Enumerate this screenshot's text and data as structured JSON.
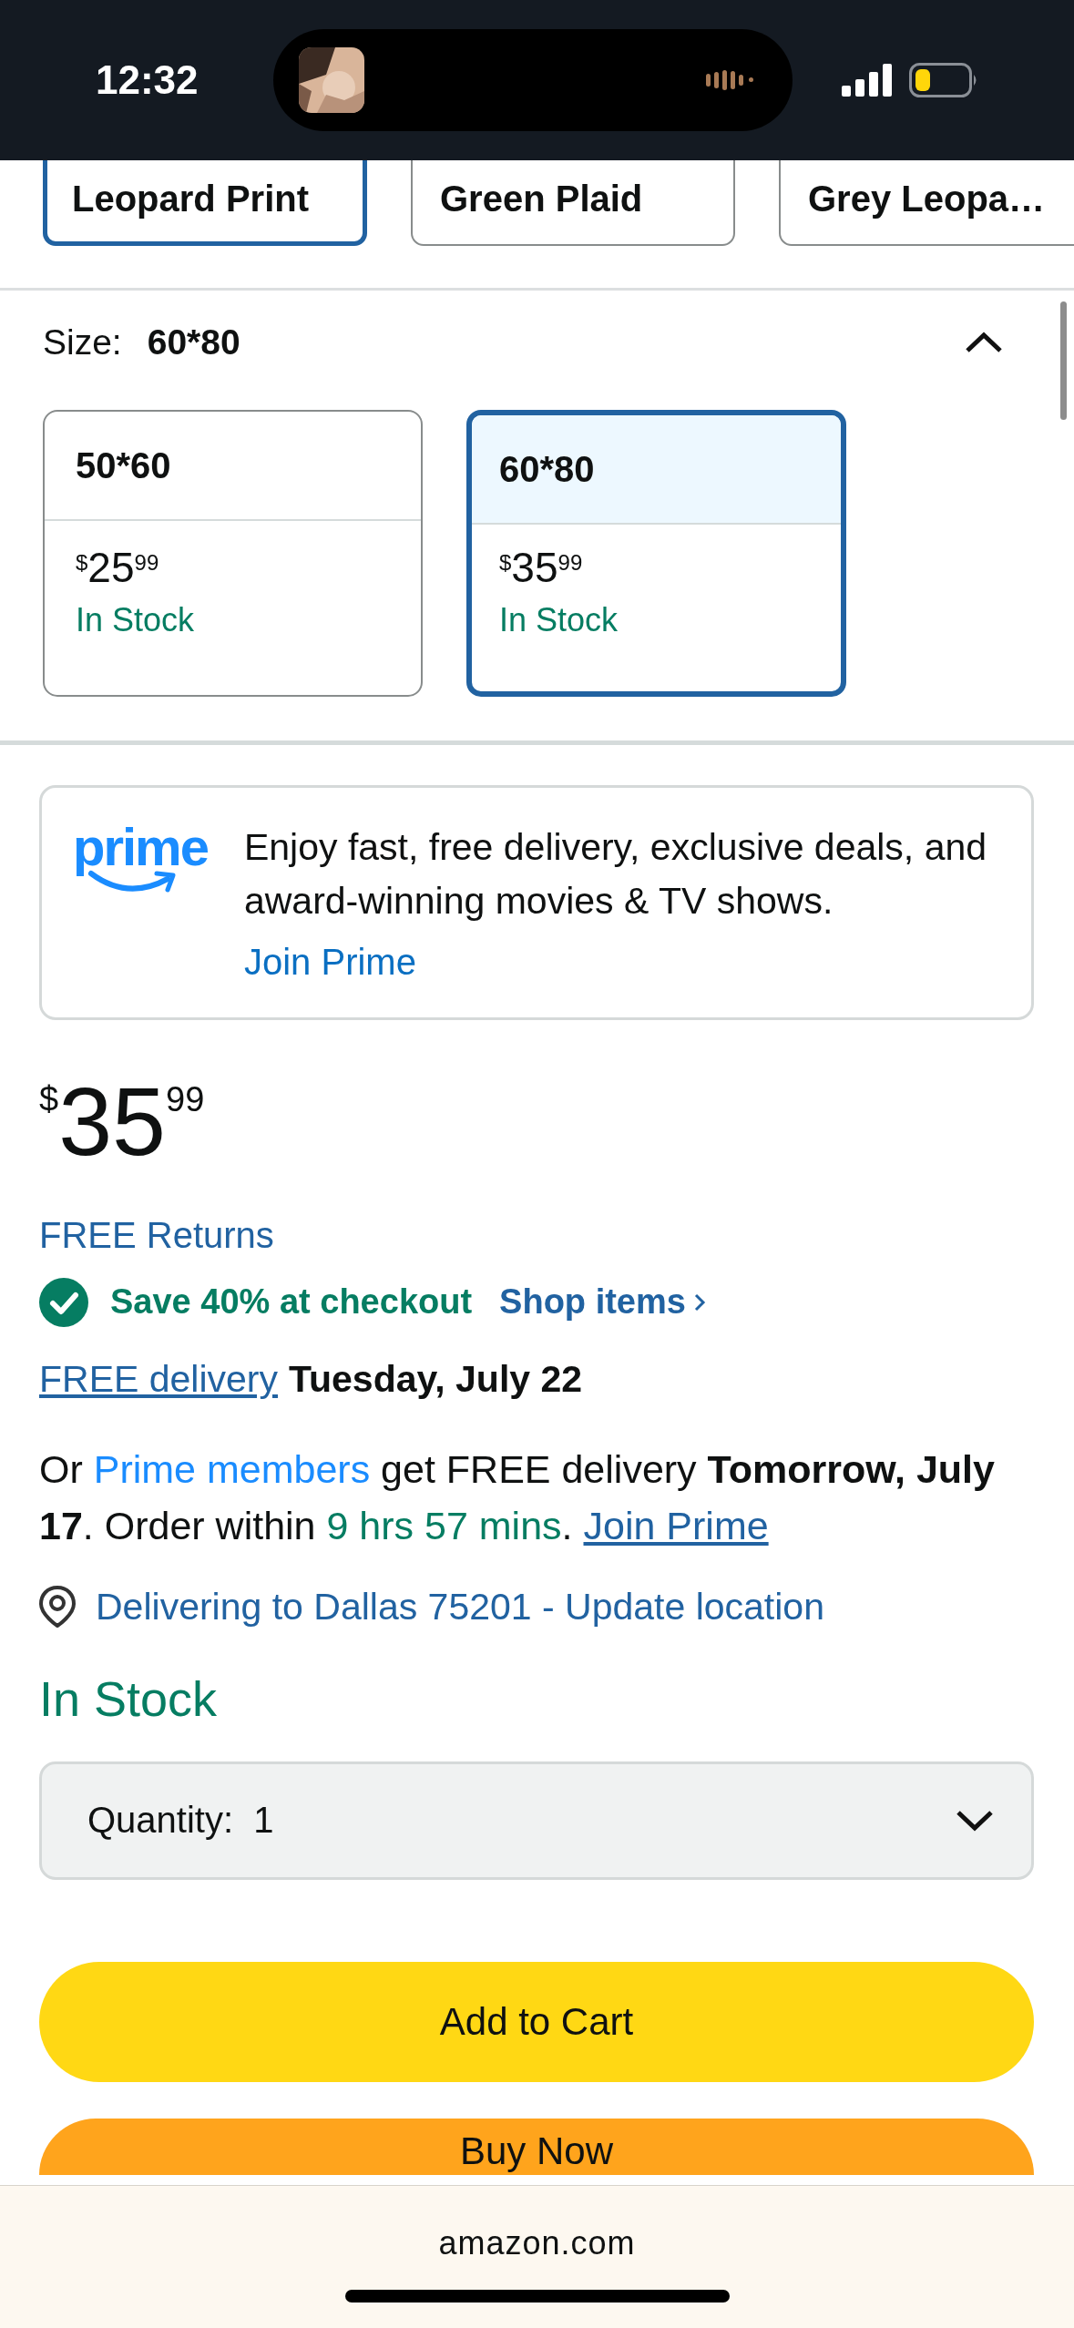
{
  "status_bar": {
    "time": "12:32"
  },
  "colors": [
    {
      "label": "Leopard Print",
      "selected": true
    },
    {
      "label": "Green Plaid",
      "selected": false
    },
    {
      "label": "Grey Leopa…",
      "selected": false
    }
  ],
  "size": {
    "label": "Size:",
    "value": "60*80",
    "expanded": true,
    "options": [
      {
        "name": "50*60",
        "currency": "$",
        "whole": "25",
        "fraction": "99",
        "stock": "In Stock",
        "selected": false
      },
      {
        "name": "60*80",
        "currency": "$",
        "whole": "35",
        "fraction": "99",
        "stock": "In Stock",
        "selected": true
      }
    ]
  },
  "prime_banner": {
    "logo": "prime",
    "text": "Enjoy fast, free delivery, exclusive deals, and award-winning movies & TV shows.",
    "link": "Join Prime"
  },
  "price": {
    "currency": "$",
    "whole": "35",
    "fraction": "99"
  },
  "returns": "FREE Returns",
  "promo": {
    "text": "Save 40% at checkout",
    "link": "Shop items"
  },
  "delivery": {
    "link": "FREE delivery",
    "date": "Tuesday, July 22"
  },
  "prime_delivery": [
    {
      "text": "Or ",
      "kind": "plain"
    },
    {
      "text": "Prime members",
      "kind": "link"
    },
    {
      "text": " get FREE delivery ",
      "kind": "plain"
    },
    {
      "text": "Tomorrow, July 17",
      "kind": "bold"
    },
    {
      "text": ". Order within ",
      "kind": "plain"
    },
    {
      "text": "9 hrs 57 mins",
      "kind": "countdown"
    },
    {
      "text": ". ",
      "kind": "plain"
    },
    {
      "text": "Join Prime",
      "kind": "underlined_link"
    }
  ],
  "location": "Delivering to Dallas 75201 - Update location",
  "availability": "In Stock",
  "quantity": {
    "label": "Quantity:",
    "value": "1"
  },
  "buttons": [
    {
      "label": "Add to Cart",
      "kind": "cart"
    },
    {
      "label": "Buy Now",
      "kind": "buy"
    }
  ],
  "browser_bar": {
    "url": "amazon.com"
  }
}
